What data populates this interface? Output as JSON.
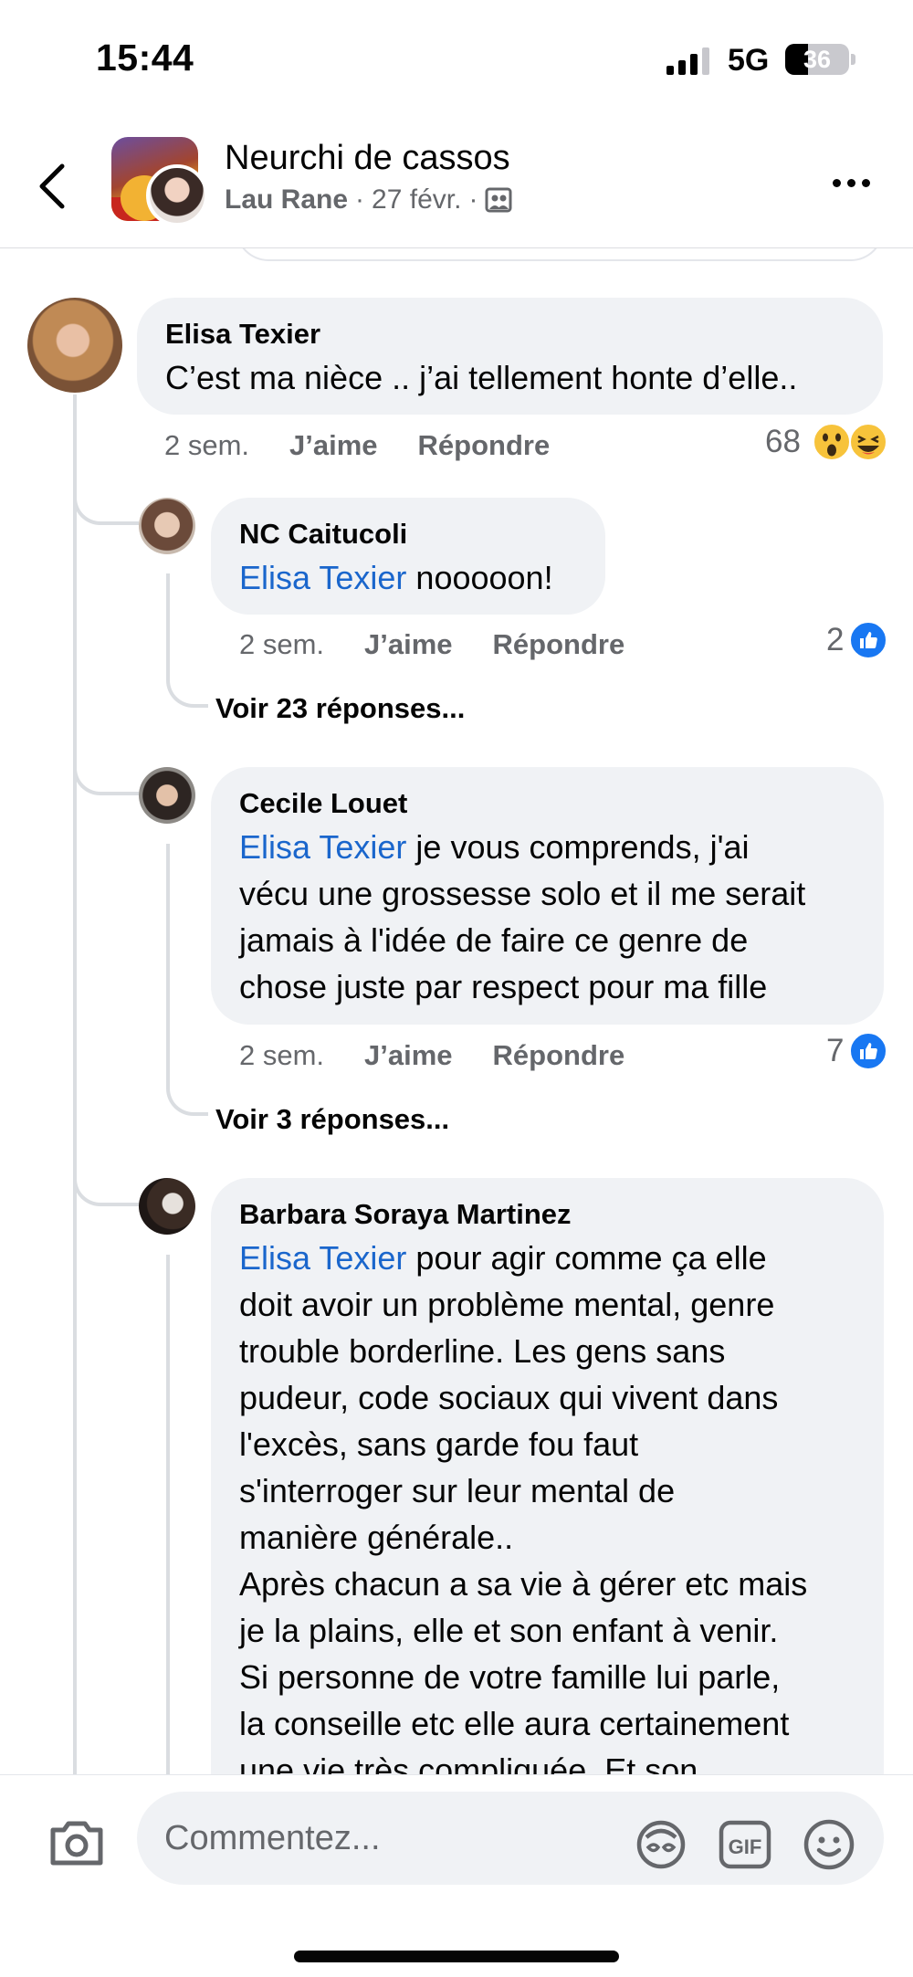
{
  "status_bar": {
    "time": "15:44",
    "network": "5G",
    "battery": "36",
    "battery_level": 0.36
  },
  "header": {
    "group_name": "Neurchi de cassos",
    "author": "Lau Rane",
    "date": "27 févr.",
    "separator": "·",
    "icons": {
      "back": "chevron-left-icon",
      "audience": "members-icon",
      "more": "more-icon"
    }
  },
  "comments": [
    {
      "name": "Elisa Texier",
      "text": "C’est ma nièce .. j’ai tellement honte d’elle..",
      "time": "2 sem.",
      "like_label": "J’aime",
      "reply_label": "Répondre",
      "reaction_count": "68",
      "reactions": [
        "wow-icon",
        "haha-icon"
      ]
    }
  ],
  "replies": [
    {
      "name": "NC Caitucoli",
      "mention": "Elisa Texier",
      "text": " nooooon!",
      "time": "2 sem.",
      "like_label": "J’aime",
      "reply_label": "Répondre",
      "reaction_count": "2",
      "view_more": "Voir 23 réponses..."
    },
    {
      "name": "Cecile Louet",
      "mention": "Elisa Texier",
      "text_lines": [
        " je vous comprends, j'ai",
        "vécu une grossesse solo et il me serait",
        "jamais à l'idée de faire ce genre de",
        "chose juste par respect pour ma fille"
      ],
      "time": "2 sem.",
      "like_label": "J’aime",
      "reply_label": "Répondre",
      "reaction_count": "7",
      "view_more": "Voir 3 réponses..."
    },
    {
      "name": "Barbara Soraya Martinez",
      "mention": "Elisa Texier",
      "text_lines": [
        " pour agir comme ça elle",
        "doit avoir un problème mental, genre",
        "trouble borderline.  Les gens sans",
        "pudeur, code sociaux qui vivent dans",
        "l'excès, sans garde fou faut",
        "s'interroger sur leur mental de",
        "manière générale..",
        "Après chacun a sa vie à gérer etc mais",
        "je la plains, elle et son enfant à venir.",
        "Si personne de votre famille lui parle,",
        "la conseille etc elle aura certainement",
        "une vie très compliquée.  Et son"
      ]
    }
  ],
  "composer": {
    "placeholder": "Commentez...",
    "icons": [
      "camera-icon",
      "avatar-sticker-icon",
      "gif-icon",
      "emoji-icon"
    ]
  },
  "colors": {
    "mention": "#1a66cc",
    "bubble": "#f0f2f5",
    "like": "#1877f2",
    "secondary_text": "#65676b"
  }
}
